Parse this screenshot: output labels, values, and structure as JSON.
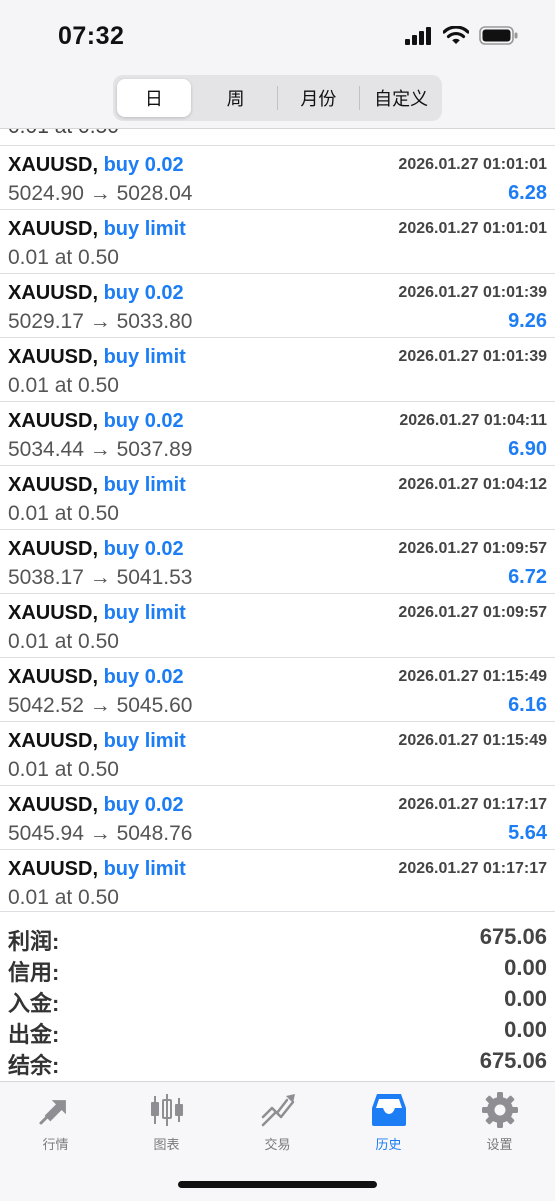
{
  "status_bar": {
    "time": "07:32"
  },
  "period_tabs": [
    {
      "label": "日",
      "active": true
    },
    {
      "label": "周",
      "active": false
    },
    {
      "label": "月份",
      "active": false
    },
    {
      "label": "自定义",
      "active": false
    }
  ],
  "partial_row_text": "0.01 at 0.50",
  "orders": [
    {
      "symbol": "XAUUSD,",
      "action": "buy 0.02",
      "time": "2026.01.27 01:01:01",
      "detail": "5024.90 → 5028.04",
      "profit": "6.28"
    },
    {
      "symbol": "XAUUSD,",
      "action": "buy limit",
      "time": "2026.01.27 01:01:01",
      "detail": "0.01 at 0.50",
      "profit": ""
    },
    {
      "symbol": "XAUUSD,",
      "action": "buy 0.02",
      "time": "2026.01.27 01:01:39",
      "detail": "5029.17 → 5033.80",
      "profit": "9.26"
    },
    {
      "symbol": "XAUUSD,",
      "action": "buy limit",
      "time": "2026.01.27 01:01:39",
      "detail": "0.01 at 0.50",
      "profit": ""
    },
    {
      "symbol": "XAUUSD,",
      "action": "buy 0.02",
      "time": "2026.01.27 01:04:11",
      "detail": "5034.44 → 5037.89",
      "profit": "6.90"
    },
    {
      "symbol": "XAUUSD,",
      "action": "buy limit",
      "time": "2026.01.27 01:04:12",
      "detail": "0.01 at 0.50",
      "profit": ""
    },
    {
      "symbol": "XAUUSD,",
      "action": "buy 0.02",
      "time": "2026.01.27 01:09:57",
      "detail": "5038.17 → 5041.53",
      "profit": "6.72"
    },
    {
      "symbol": "XAUUSD,",
      "action": "buy limit",
      "time": "2026.01.27 01:09:57",
      "detail": "0.01 at 0.50",
      "profit": ""
    },
    {
      "symbol": "XAUUSD,",
      "action": "buy 0.02",
      "time": "2026.01.27 01:15:49",
      "detail": "5042.52 → 5045.60",
      "profit": "6.16"
    },
    {
      "symbol": "XAUUSD,",
      "action": "buy limit",
      "time": "2026.01.27 01:15:49",
      "detail": "0.01 at 0.50",
      "profit": ""
    },
    {
      "symbol": "XAUUSD,",
      "action": "buy 0.02",
      "time": "2026.01.27 01:17:17",
      "detail": "5045.94 → 5048.76",
      "profit": "5.64"
    },
    {
      "symbol": "XAUUSD,",
      "action": "buy limit",
      "time": "2026.01.27 01:17:17",
      "detail": "0.01 at 0.50",
      "profit": ""
    }
  ],
  "summary": [
    {
      "label": "利润:",
      "value": "675.06"
    },
    {
      "label": "信用:",
      "value": "0.00"
    },
    {
      "label": "入金:",
      "value": "0.00"
    },
    {
      "label": "出金:",
      "value": "0.00"
    },
    {
      "label": "结余:",
      "value": "675.06"
    }
  ],
  "tab_bar": [
    {
      "label": "行情",
      "icon": "quotes-icon",
      "active": false
    },
    {
      "label": "图表",
      "icon": "chart-icon",
      "active": false
    },
    {
      "label": "交易",
      "icon": "trade-icon",
      "active": false
    },
    {
      "label": "历史",
      "icon": "history-icon",
      "active": true
    },
    {
      "label": "设置",
      "icon": "gear-icon",
      "active": false
    }
  ],
  "colors": {
    "accent": "#1d7df5",
    "text": "#111111",
    "muted": "#555555",
    "separator": "#dedee2"
  }
}
